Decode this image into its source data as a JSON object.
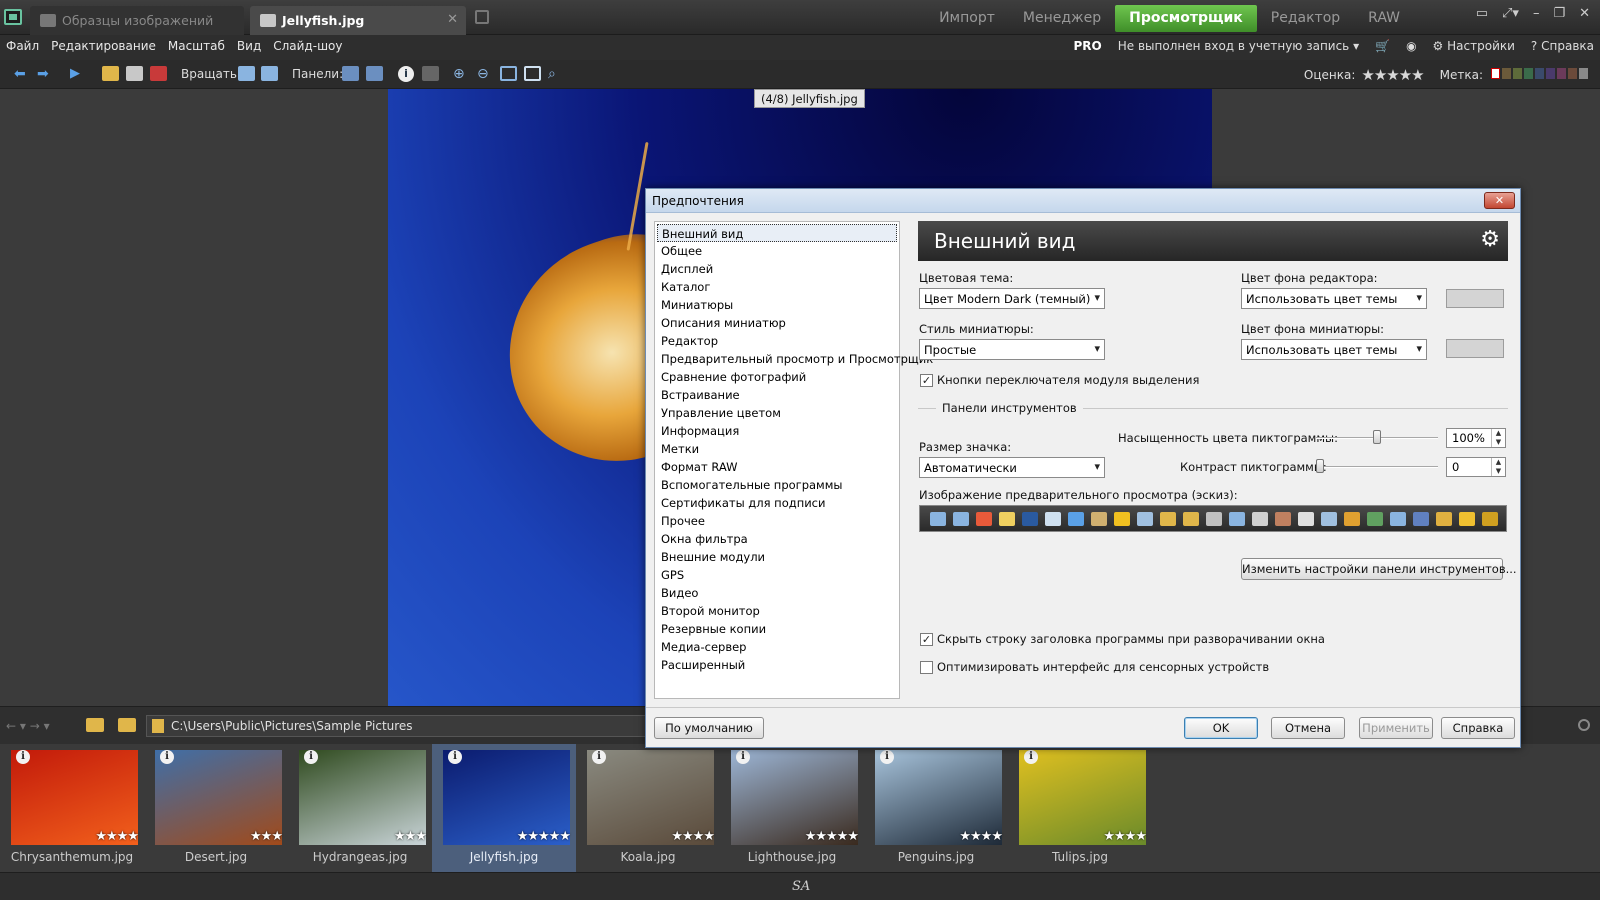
{
  "tabs": [
    {
      "label": "Образцы изображений"
    },
    {
      "label": "Jellyfish.jpg"
    }
  ],
  "modes": [
    "Импорт",
    "Менеджер",
    "Просмотрщик",
    "Редактор",
    "RAW"
  ],
  "active_mode": "Просмотрщик",
  "menu": [
    "Файл",
    "Редактирование",
    "Масштаб",
    "Вид",
    "Слайд-шоу"
  ],
  "menu_right": {
    "pro": "PRO",
    "account": "Не выполнен вход в учетную запись",
    "settings": "Настройки",
    "help": "Справка"
  },
  "toolbar": {
    "rotate_label": "Вращать:",
    "panels_label": "Панели:",
    "rating_label": "Оценка:",
    "rating_stars": "★★★★★",
    "label_label": "Метка:"
  },
  "colors": {
    "accent_mode": "#4fae36",
    "label_swatches": [
      "#6b5a3a",
      "#5e6b3a",
      "#3a6b4a",
      "#3a4a6b",
      "#4a3a6b",
      "#6b3a5a",
      "#6b4a3a",
      "#8a8a8a"
    ]
  },
  "photo_caption": "(4/8) Jellyfish.jpg",
  "dialog": {
    "title": "Предпочтения",
    "close": "✕",
    "nav_items": [
      "Внешний вид",
      "Общее",
      "Дисплей",
      "Каталог",
      "Миниатюры",
      "Описания миниатюр",
      "Редактор",
      "Предварительный просмотр и Просмотрщик",
      "Сравнение фотографий",
      "Встраивание",
      "Управление цветом",
      "Информация",
      "Метки",
      "Формат RAW",
      "Вспомогательные программы",
      "Сертификаты для подписи",
      "Прочее",
      "Окна фильтра",
      "Внешние модули",
      "GPS",
      "Видео",
      "Второй монитор",
      "Резервные копии",
      "Медиа-сервер",
      "Расширенный"
    ],
    "selected_item": "Внешний вид",
    "panel_title": "Внешний вид",
    "color_theme_label": "Цветовая тема:",
    "color_theme_value": "Цвет Modern Dark (темный)",
    "editor_bg_label": "Цвет фона редактора:",
    "editor_bg_value": "Использовать цвет темы",
    "thumb_style_label": "Стиль миниатюры:",
    "thumb_style_value": "Простые",
    "thumb_bg_label": "Цвет фона миниатюры:",
    "thumb_bg_value": "Использовать цвет темы",
    "module_switch_checkbox": "Кнопки переключателя модуля выделения",
    "module_switch_checked": true,
    "toolbars_group": "Панели инструментов",
    "icon_size_label": "Размер значка:",
    "icon_size_value": "Автоматически",
    "saturation_label": "Насыщенность цвета пиктограммы:",
    "saturation_value": "100%",
    "saturation_level": 0.5,
    "contrast_label": "Контраст пиктограммы:",
    "contrast_value": "0",
    "contrast_level": 0.0,
    "preview_label": "Изображение предварительного просмотра (эскиз):",
    "customize_button": "Изменить настройки панели инструментов...",
    "hide_titlebar_checkbox": "Скрыть строку заголовка программы при разворачивании окна",
    "hide_titlebar_checked": true,
    "touch_checkbox": "Оптимизировать интерфейс для сенсорных устройств",
    "touch_checked": false,
    "default_button": "По умолчанию",
    "ok_button": "OK",
    "cancel_button": "Отмена",
    "apply_button": "Применить",
    "help_button": "Справка"
  },
  "path": "C:\\Users\\Public\\Pictures\\Sample Pictures",
  "thumbnails": [
    {
      "name": "Chrysanthemum.jpg",
      "stars": "★★★★",
      "colors": [
        "#c21a0a",
        "#f2601c"
      ]
    },
    {
      "name": "Desert.jpg",
      "stars": "★★★",
      "colors": [
        "#3f6fa8",
        "#a14a1a"
      ]
    },
    {
      "name": "Hydrangeas.jpg",
      "stars": "★★★",
      "colors": [
        "#2f4a1e",
        "#c9d4d8"
      ]
    },
    {
      "name": "Jellyfish.jpg",
      "stars": "★★★★★",
      "colors": [
        "#0b1b6e",
        "#2b5fc9"
      ]
    },
    {
      "name": "Koala.jpg",
      "stars": "★★★★",
      "colors": [
        "#8a8a80",
        "#5a4a3a"
      ]
    },
    {
      "name": "Lighthouse.jpg",
      "stars": "★★★★★",
      "colors": [
        "#9db6d6",
        "#3a2a1e"
      ]
    },
    {
      "name": "Penguins.jpg",
      "stars": "★★★★",
      "colors": [
        "#a8c4dc",
        "#1e2a38"
      ]
    },
    {
      "name": "Tulips.jpg",
      "stars": "★★★★",
      "colors": [
        "#e0c020",
        "#6a8a2a"
      ]
    }
  ],
  "selected_thumbnail": "Jellyfish.jpg",
  "status_logo": "SA"
}
